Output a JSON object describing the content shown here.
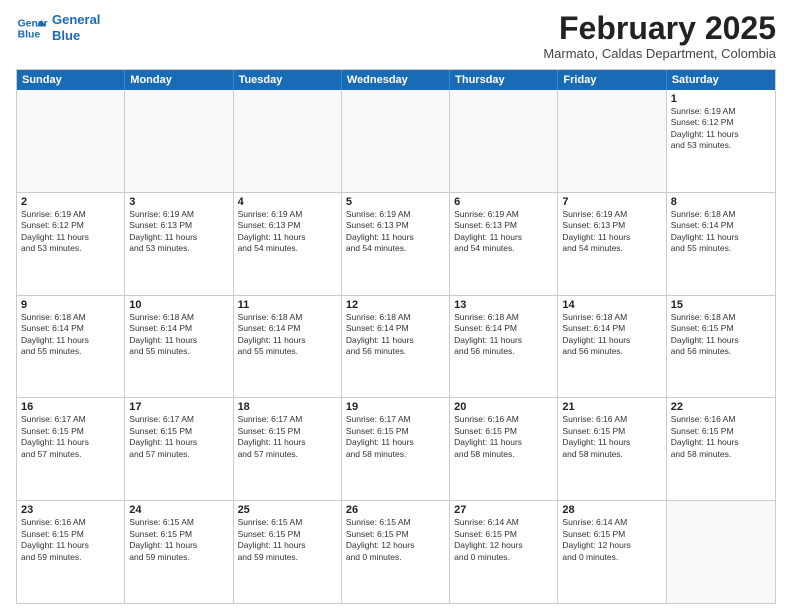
{
  "header": {
    "logo_line1": "General",
    "logo_line2": "Blue",
    "month_title": "February 2025",
    "location": "Marmato, Caldas Department, Colombia"
  },
  "weekdays": [
    "Sunday",
    "Monday",
    "Tuesday",
    "Wednesday",
    "Thursday",
    "Friday",
    "Saturday"
  ],
  "rows": [
    {
      "cells": [
        {
          "day": "",
          "info": ""
        },
        {
          "day": "",
          "info": ""
        },
        {
          "day": "",
          "info": ""
        },
        {
          "day": "",
          "info": ""
        },
        {
          "day": "",
          "info": ""
        },
        {
          "day": "",
          "info": ""
        },
        {
          "day": "1",
          "info": "Sunrise: 6:19 AM\nSunset: 6:12 PM\nDaylight: 11 hours\nand 53 minutes."
        }
      ]
    },
    {
      "cells": [
        {
          "day": "2",
          "info": "Sunrise: 6:19 AM\nSunset: 6:12 PM\nDaylight: 11 hours\nand 53 minutes."
        },
        {
          "day": "3",
          "info": "Sunrise: 6:19 AM\nSunset: 6:13 PM\nDaylight: 11 hours\nand 53 minutes."
        },
        {
          "day": "4",
          "info": "Sunrise: 6:19 AM\nSunset: 6:13 PM\nDaylight: 11 hours\nand 54 minutes."
        },
        {
          "day": "5",
          "info": "Sunrise: 6:19 AM\nSunset: 6:13 PM\nDaylight: 11 hours\nand 54 minutes."
        },
        {
          "day": "6",
          "info": "Sunrise: 6:19 AM\nSunset: 6:13 PM\nDaylight: 11 hours\nand 54 minutes."
        },
        {
          "day": "7",
          "info": "Sunrise: 6:19 AM\nSunset: 6:13 PM\nDaylight: 11 hours\nand 54 minutes."
        },
        {
          "day": "8",
          "info": "Sunrise: 6:18 AM\nSunset: 6:14 PM\nDaylight: 11 hours\nand 55 minutes."
        }
      ]
    },
    {
      "cells": [
        {
          "day": "9",
          "info": "Sunrise: 6:18 AM\nSunset: 6:14 PM\nDaylight: 11 hours\nand 55 minutes."
        },
        {
          "day": "10",
          "info": "Sunrise: 6:18 AM\nSunset: 6:14 PM\nDaylight: 11 hours\nand 55 minutes."
        },
        {
          "day": "11",
          "info": "Sunrise: 6:18 AM\nSunset: 6:14 PM\nDaylight: 11 hours\nand 55 minutes."
        },
        {
          "day": "12",
          "info": "Sunrise: 6:18 AM\nSunset: 6:14 PM\nDaylight: 11 hours\nand 56 minutes."
        },
        {
          "day": "13",
          "info": "Sunrise: 6:18 AM\nSunset: 6:14 PM\nDaylight: 11 hours\nand 56 minutes."
        },
        {
          "day": "14",
          "info": "Sunrise: 6:18 AM\nSunset: 6:14 PM\nDaylight: 11 hours\nand 56 minutes."
        },
        {
          "day": "15",
          "info": "Sunrise: 6:18 AM\nSunset: 6:15 PM\nDaylight: 11 hours\nand 56 minutes."
        }
      ]
    },
    {
      "cells": [
        {
          "day": "16",
          "info": "Sunrise: 6:17 AM\nSunset: 6:15 PM\nDaylight: 11 hours\nand 57 minutes."
        },
        {
          "day": "17",
          "info": "Sunrise: 6:17 AM\nSunset: 6:15 PM\nDaylight: 11 hours\nand 57 minutes."
        },
        {
          "day": "18",
          "info": "Sunrise: 6:17 AM\nSunset: 6:15 PM\nDaylight: 11 hours\nand 57 minutes."
        },
        {
          "day": "19",
          "info": "Sunrise: 6:17 AM\nSunset: 6:15 PM\nDaylight: 11 hours\nand 58 minutes."
        },
        {
          "day": "20",
          "info": "Sunrise: 6:16 AM\nSunset: 6:15 PM\nDaylight: 11 hours\nand 58 minutes."
        },
        {
          "day": "21",
          "info": "Sunrise: 6:16 AM\nSunset: 6:15 PM\nDaylight: 11 hours\nand 58 minutes."
        },
        {
          "day": "22",
          "info": "Sunrise: 6:16 AM\nSunset: 6:15 PM\nDaylight: 11 hours\nand 58 minutes."
        }
      ]
    },
    {
      "cells": [
        {
          "day": "23",
          "info": "Sunrise: 6:16 AM\nSunset: 6:15 PM\nDaylight: 11 hours\nand 59 minutes."
        },
        {
          "day": "24",
          "info": "Sunrise: 6:15 AM\nSunset: 6:15 PM\nDaylight: 11 hours\nand 59 minutes."
        },
        {
          "day": "25",
          "info": "Sunrise: 6:15 AM\nSunset: 6:15 PM\nDaylight: 11 hours\nand 59 minutes."
        },
        {
          "day": "26",
          "info": "Sunrise: 6:15 AM\nSunset: 6:15 PM\nDaylight: 12 hours\nand 0 minutes."
        },
        {
          "day": "27",
          "info": "Sunrise: 6:14 AM\nSunset: 6:15 PM\nDaylight: 12 hours\nand 0 minutes."
        },
        {
          "day": "28",
          "info": "Sunrise: 6:14 AM\nSunset: 6:15 PM\nDaylight: 12 hours\nand 0 minutes."
        },
        {
          "day": "",
          "info": ""
        }
      ]
    }
  ]
}
